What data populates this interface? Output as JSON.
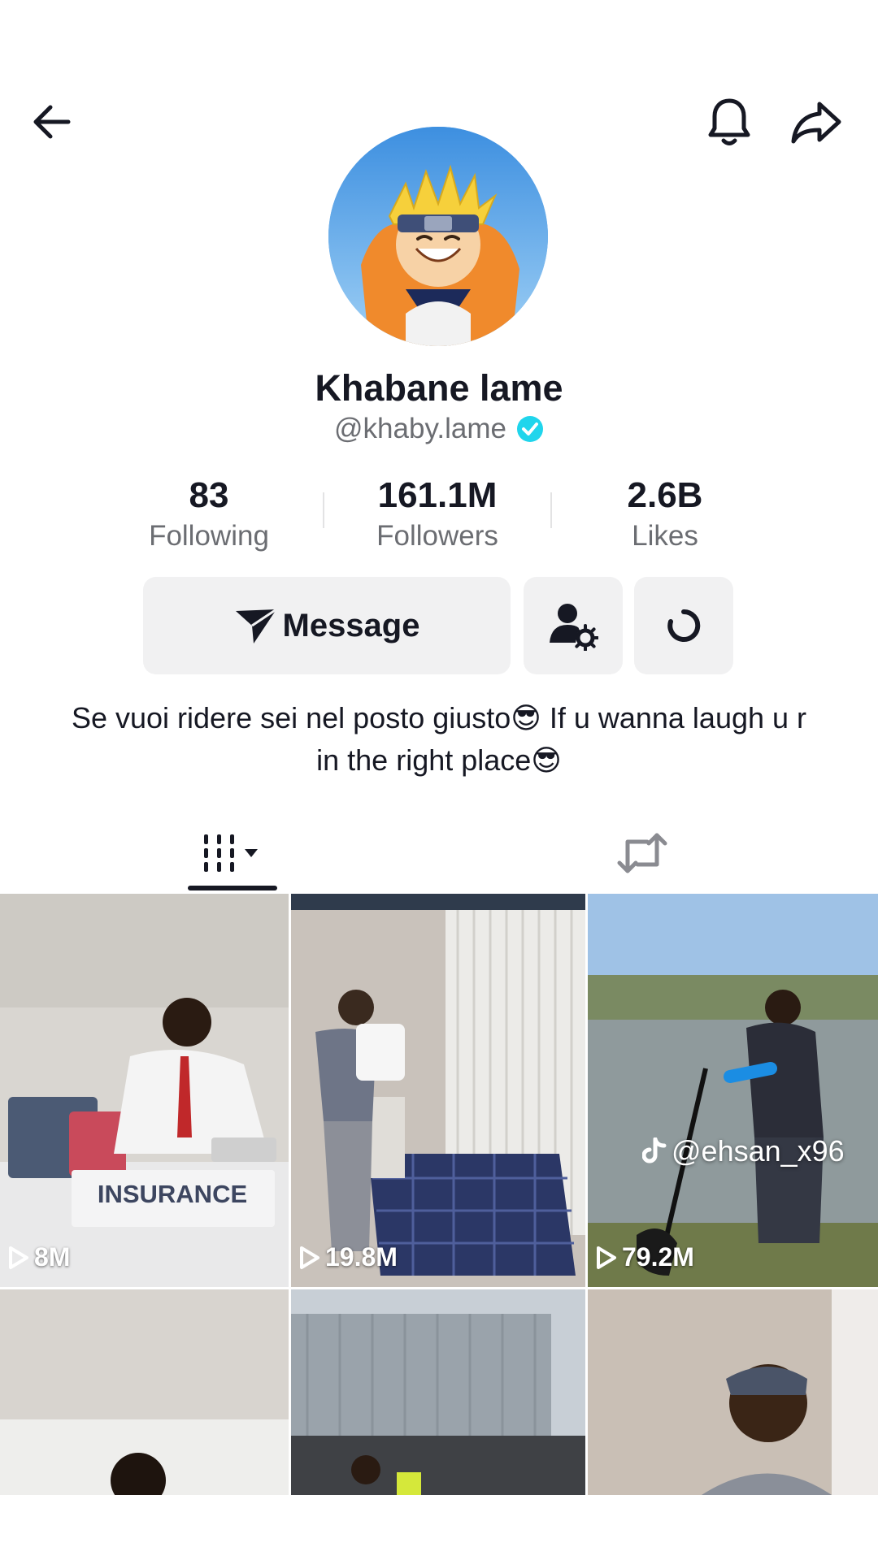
{
  "profile": {
    "name": "Khabane lame",
    "handle": "@khaby.lame",
    "bio": "Se vuoi ridere sei nel posto giusto😎 If u wanna laugh u r in the right place😎"
  },
  "stats": [
    {
      "value": "83",
      "label": "Following"
    },
    {
      "value": "161.1M",
      "label": "Followers"
    },
    {
      "value": "2.6B",
      "label": "Likes"
    }
  ],
  "actions": {
    "message_label": "Message"
  },
  "icons": {
    "back": "back-arrow-icon",
    "bell": "bell-icon",
    "share": "share-arrow-icon",
    "verified": "verified-badge-icon",
    "message": "send-icon",
    "follow_settings": "user-gear-icon",
    "more": "refresh-icon",
    "videos_tab": "grid-icon",
    "reposts_tab": "repost-icon",
    "play": "play-icon"
  },
  "colors": {
    "verified": "#20D5EC",
    "text": "#161823",
    "secondary": "#6b6d72",
    "button_bg": "#f1f1f2"
  },
  "videos": [
    {
      "views": "8M",
      "caption": "INSURANCE"
    },
    {
      "views": "19.8M"
    },
    {
      "views": "79.2M",
      "watermark": "@ehsan_x96"
    },
    {},
    {},
    {}
  ]
}
